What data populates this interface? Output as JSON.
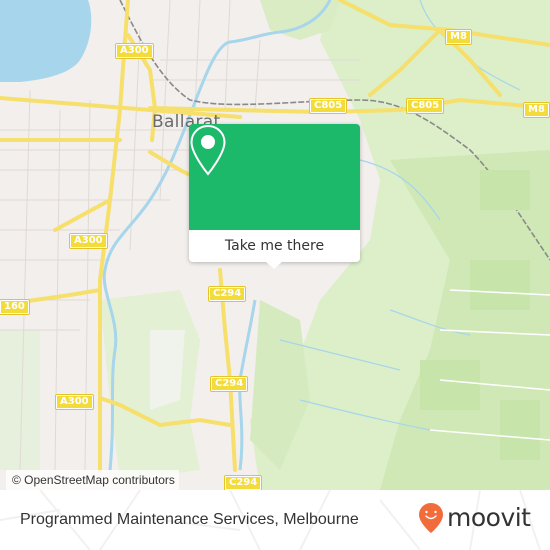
{
  "map": {
    "city_label": "Ballarat",
    "road_shields": [
      {
        "id": "a300-north",
        "label": "A300"
      },
      {
        "id": "m8-north",
        "label": "M8"
      },
      {
        "id": "c805-center",
        "label": "C805"
      },
      {
        "id": "c805-east",
        "label": "C805"
      },
      {
        "id": "m8-east",
        "label": "M8"
      },
      {
        "id": "a300-west",
        "label": "A300"
      },
      {
        "id": "c160-west",
        "label": "160"
      },
      {
        "id": "c294-north",
        "label": "C294"
      },
      {
        "id": "c294-mid",
        "label": "C294"
      },
      {
        "id": "a300-south",
        "label": "A300"
      },
      {
        "id": "c294-south",
        "label": "C294"
      }
    ],
    "attribution": "© OpenStreetMap contributors",
    "colors": {
      "water": "#a6d5ec",
      "park": "#d6eec0",
      "road": "#f6df6a",
      "urban": "#ece6e2"
    }
  },
  "popup": {
    "icon": "location-pin-icon",
    "button_label": "Take me there",
    "color": "#1db96a"
  },
  "footer": {
    "place_name": "Programmed Maintenance Services, Melbourne",
    "logo": {
      "icon": "moovit-pin-icon",
      "text": "moovit",
      "color": "#f26b3a"
    }
  }
}
